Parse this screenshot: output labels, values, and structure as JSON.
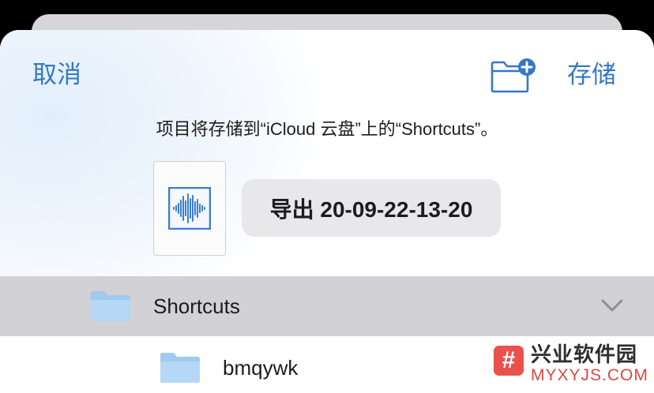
{
  "nav": {
    "cancel_label": "取消",
    "save_label": "存储",
    "new_folder_icon": "folder-plus-icon"
  },
  "message": "项目将存储到“iCloud 云盘”上的“Shortcuts”。",
  "file": {
    "thumbnail_icon": "audio-waveform-icon",
    "name": "导出 20-09-22-13-20"
  },
  "location": {
    "selected_folder": "Shortcuts",
    "expand_icon": "chevron-down-icon",
    "subfolders": [
      "bmqywk"
    ]
  },
  "watermark": {
    "title": "兴业软件园",
    "subtitle": "MYXYJS.COM"
  },
  "colors": {
    "accent": "#3478c6",
    "folder": "#9ecbef",
    "selected_row": "#d1d1d6",
    "name_field": "#e8e8ea",
    "watermark_red": "#e8514c"
  }
}
